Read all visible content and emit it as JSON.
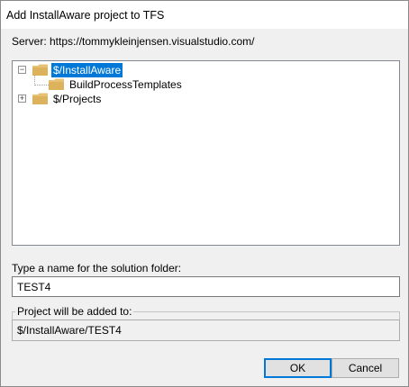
{
  "window": {
    "title": "Add InstallAware project to TFS"
  },
  "server": {
    "label": "Server: https://tommykleinjensen.visualstudio.com/"
  },
  "tree": {
    "nodes": [
      {
        "label": "$/InstallAware",
        "expander": "−",
        "selected": true
      },
      {
        "label": "BuildProcessTemplates",
        "expander": "",
        "selected": false
      },
      {
        "label": "$/Projects",
        "expander": "+",
        "selected": false
      }
    ]
  },
  "solution_folder": {
    "label": "Type a name for the solution folder:",
    "value": "TEST4"
  },
  "target": {
    "label": "Project will be added to:",
    "value": "$/InstallAware/TEST4"
  },
  "buttons": {
    "ok": "OK",
    "cancel": "Cancel"
  },
  "colors": {
    "selection": "#0078d7",
    "folder": "#dcb35c",
    "accent": "#0078d7"
  },
  "icons": {
    "folder": "folder-icon",
    "expand": "plus-box-icon",
    "collapse": "minus-box-icon"
  }
}
